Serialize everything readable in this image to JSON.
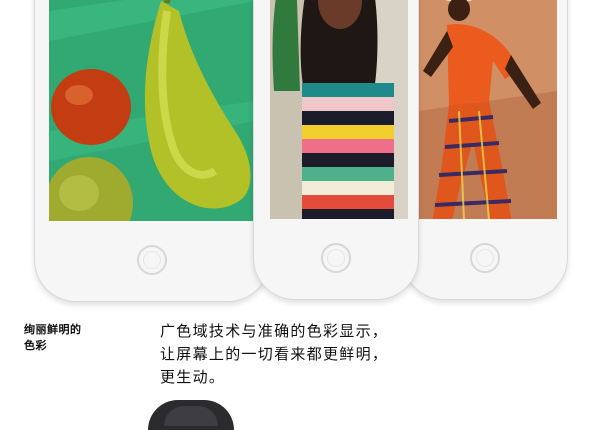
{
  "phones": [
    {
      "name": "fruit-photo"
    },
    {
      "name": "stripes-photo"
    },
    {
      "name": "dancer-photo"
    }
  ],
  "caption": {
    "title": "绚丽鲜明的\n色彩",
    "body_lines": [
      "广色域技术与准确的色彩显示，",
      "让屏幕上的一切看来都更鲜明，",
      "更生动。"
    ]
  }
}
